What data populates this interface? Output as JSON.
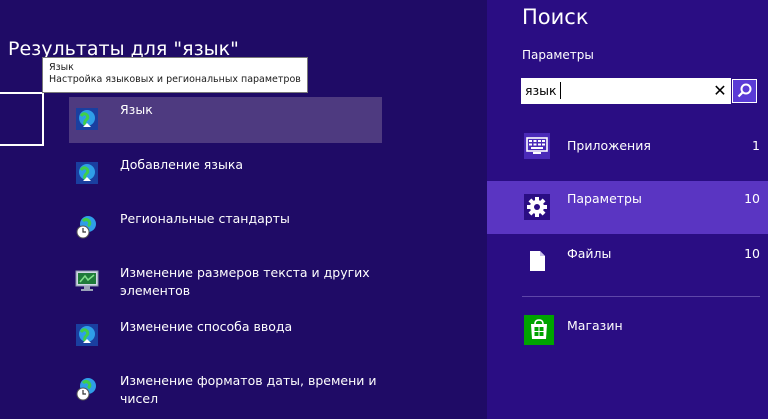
{
  "results": {
    "title": "Результаты для \"язык\"",
    "tooltip": {
      "title": "Язык",
      "description": "Настройка языковых и региональных параметров"
    },
    "items": [
      {
        "label": "Язык",
        "icon": "language-globe-icon",
        "selected": true
      },
      {
        "label": "Добавление языка",
        "icon": "language-globe-icon"
      },
      {
        "label": "Региональные стандарты",
        "icon": "region-globe-clock-icon"
      },
      {
        "label": "Изменение размеров текста и других элементов",
        "icon": "display-monitor-icon"
      },
      {
        "label": "Изменение способа ввода",
        "icon": "language-globe-icon"
      },
      {
        "label": "Изменение форматов даты, времени и чисел",
        "icon": "region-globe-clock-icon"
      }
    ]
  },
  "search": {
    "heading": "Поиск",
    "scope_label": "Параметры",
    "query": "язык",
    "clear_icon": "close-icon",
    "go_icon": "search-icon",
    "scopes": [
      {
        "name": "Приложения",
        "count": "1",
        "icon": "apps-keyboard-icon",
        "icon_bg": "#4a2ab8"
      },
      {
        "name": "Параметры",
        "count": "10",
        "icon": "gear-icon",
        "selected": true,
        "icon_bg": "#2a0d83"
      },
      {
        "name": "Файлы",
        "count": "10",
        "icon": "file-icon",
        "icon_bg": "#2a0d83"
      },
      {
        "name": "Магазин",
        "count": "",
        "icon": "store-icon",
        "icon_bg": "#00a300"
      }
    ]
  },
  "colors": {
    "results_bg": "#1f0b66",
    "search_bg": "#2a0d83",
    "selected_scope": "#5a35c2",
    "selected_result": "#4e3a80",
    "store_green": "#00a300"
  }
}
